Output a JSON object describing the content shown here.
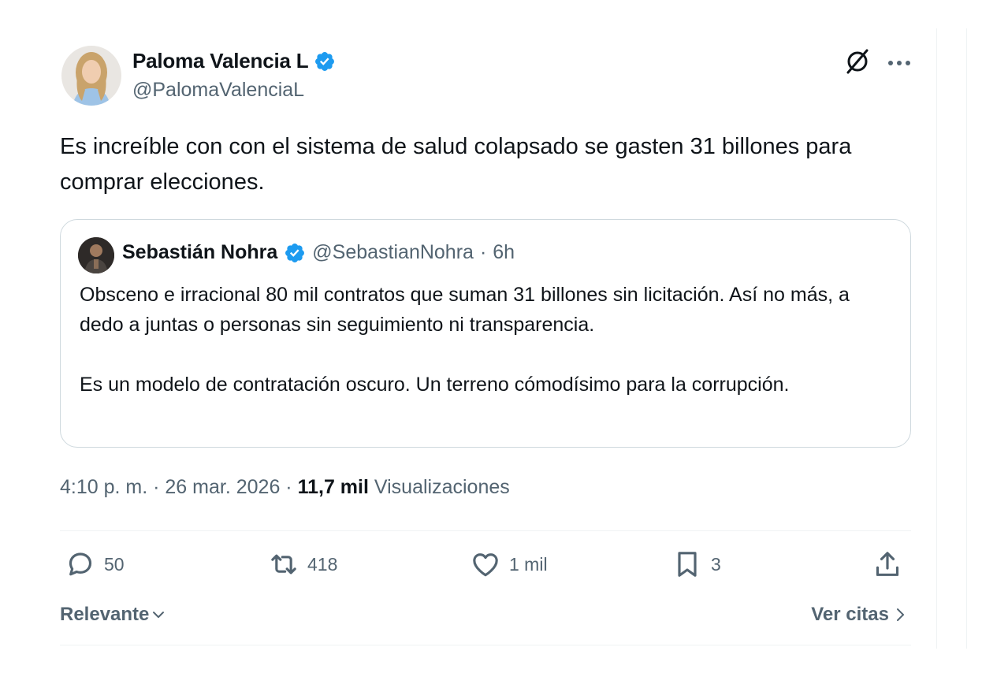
{
  "author": {
    "name": "Paloma Valencia L",
    "handle": "@PalomaValenciaL"
  },
  "tweet": {
    "text": "Es increíble con con el sistema de salud colapsado se gasten 31 billones para comprar elecciones."
  },
  "quoted": {
    "name": "Sebastián Nohra",
    "handle": "@SebastianNohra",
    "separator": "·",
    "time": "6h",
    "paragraph1": "Obsceno e irracional 80 mil contratos que suman 31 billones sin licitación. Así no más, a dedo a juntas o personas sin seguimiento ni transparencia.",
    "paragraph2": "Es un modelo de contratación oscuro. Un terreno cómodísimo para la corrupción."
  },
  "meta": {
    "time": "4:10 p. m.",
    "sep1": "·",
    "date": "26 mar. 2026",
    "sep2": "·",
    "views_count": "11,7 mil",
    "views_label": "Visualizaciones"
  },
  "actions": {
    "replies": "50",
    "retweets": "418",
    "likes": "1 mil",
    "bookmarks": "3"
  },
  "footer": {
    "sort_label": "Relevante",
    "quotes_label": "Ver citas"
  },
  "icons": {
    "verified": "verified-badge-icon",
    "grok": "grok-icon",
    "more": "more-icon",
    "reply": "reply-icon",
    "retweet": "retweet-icon",
    "like": "heart-icon",
    "bookmark": "bookmark-icon",
    "share": "share-icon"
  },
  "colors": {
    "verified_blue": "#1d9bf0",
    "text_primary": "#0f1419",
    "text_secondary": "#536471",
    "border": "#cfd9de"
  }
}
